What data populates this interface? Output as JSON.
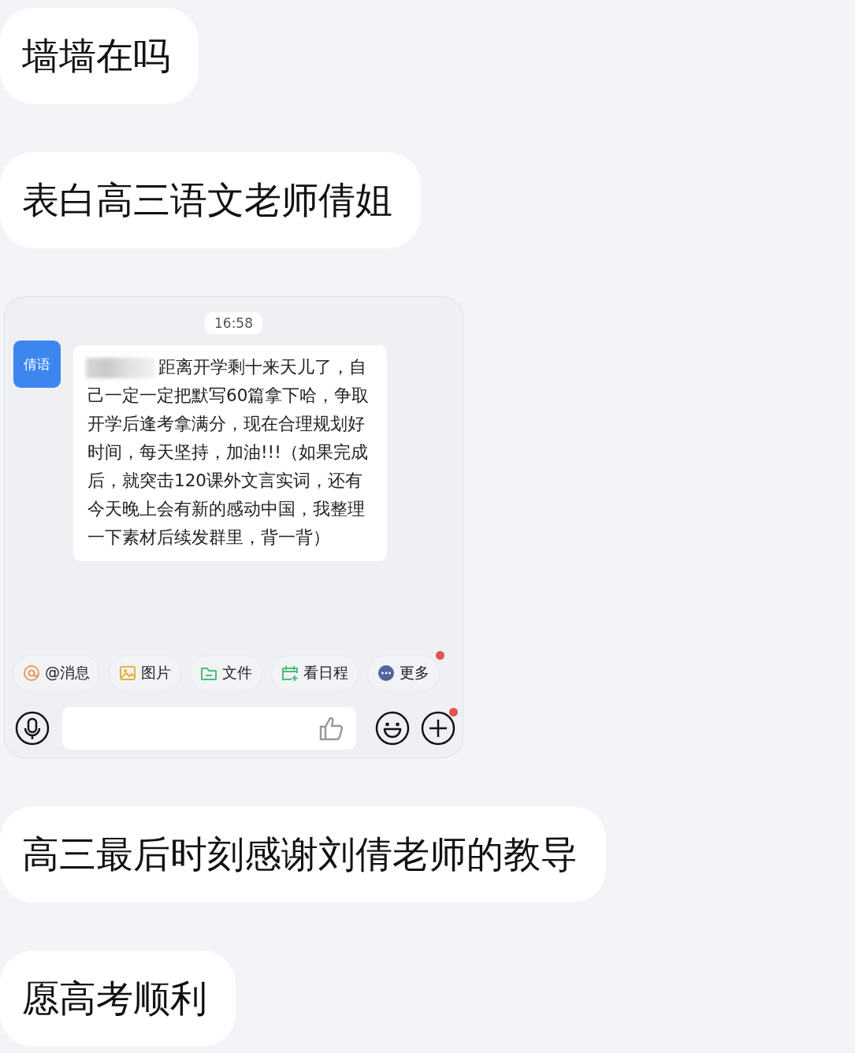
{
  "messages": [
    {
      "kind": "text",
      "text": "墙墙在吗"
    },
    {
      "kind": "text",
      "text": "表白高三语文老师倩姐"
    },
    {
      "kind": "screenshot",
      "time": "16:58",
      "avatar": "倩语",
      "redacted": true,
      "message": "距离开学剩十来天儿了，自己一定一定把默写60篇拿下哈，争取开学后逢考拿满分，现在合理规划好时间，每天坚持，加油!!!（如果完成后，就突击120课外文言实词，还有今天晚上会有新的感动中国，我整理一下素材后续发群里，背一背）",
      "toolbar": [
        {
          "kind": "mention",
          "label": "@消息",
          "badge": false
        },
        {
          "kind": "image",
          "label": "图片",
          "badge": false
        },
        {
          "kind": "file",
          "label": "文件",
          "badge": false
        },
        {
          "kind": "calendar",
          "label": "看日程",
          "badge": false
        },
        {
          "kind": "more",
          "label": "更多",
          "badge": true
        }
      ],
      "plus_badge": true
    },
    {
      "kind": "text",
      "text": "高三最后时刻感谢刘倩老师的教导"
    },
    {
      "kind": "text",
      "text": "愿高考顺利"
    }
  ]
}
